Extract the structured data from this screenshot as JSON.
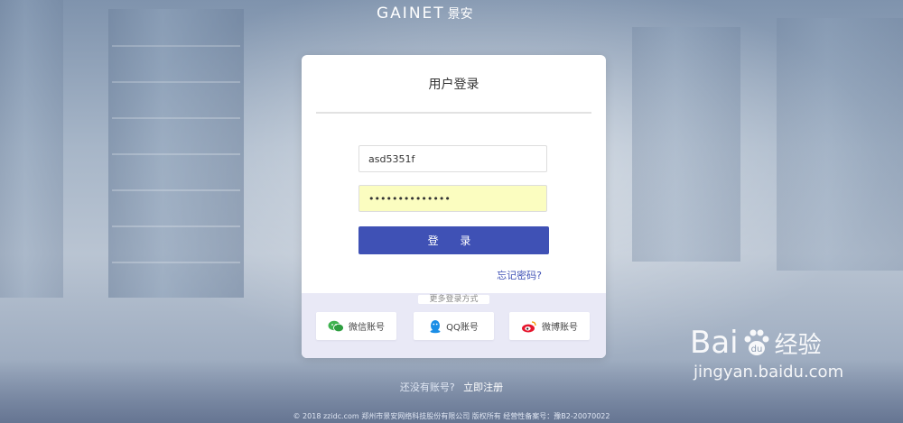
{
  "header": {
    "brand": "GAINET",
    "brand_sub": "景安"
  },
  "login": {
    "title": "用户登录",
    "username_value": "asd5351f",
    "password_mask": "••••••••••••••",
    "login_button": "登 录",
    "forgot_link": "忘记密码?",
    "social_label": "更多登录方式",
    "social": [
      {
        "label": "微信账号",
        "icon": "wechat-icon"
      },
      {
        "label": "QQ账号",
        "icon": "qq-icon"
      },
      {
        "label": "微博账号",
        "icon": "weibo-icon"
      }
    ]
  },
  "register": {
    "question": "还没有账号?",
    "link": "立即注册"
  },
  "footer": {
    "text": "© 2018 zzidc.com  郑州市景安网络科技股份有限公司 版权所有 经营性备案号：豫B2-20070022"
  },
  "watermark": {
    "line1_left": "Bai",
    "line1_right": "经验",
    "line2": "jingyan.baidu.com"
  },
  "colors": {
    "primary": "#3f51b5",
    "autofill": "#fbfdc0",
    "social_bg": "#e9e9f6"
  }
}
